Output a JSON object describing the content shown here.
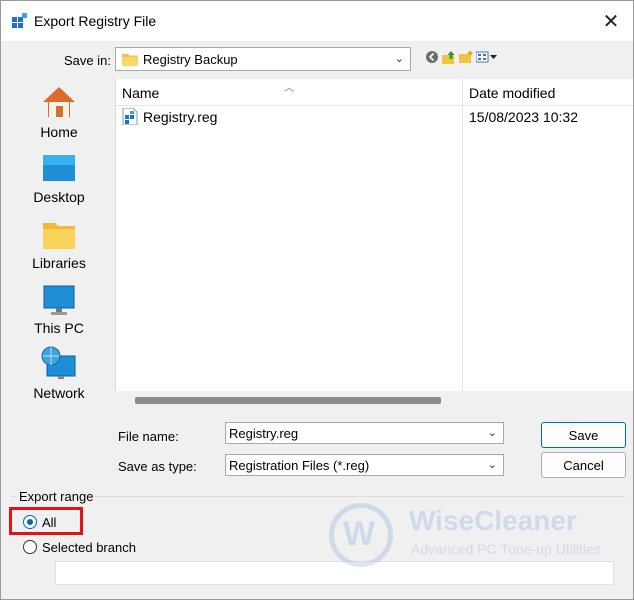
{
  "window": {
    "title": "Export Registry File"
  },
  "save_in": {
    "label": "Save in:",
    "value": "Registry Backup"
  },
  "places": [
    {
      "label": "Home",
      "icon": "home-icon"
    },
    {
      "label": "Desktop",
      "icon": "desktop-icon"
    },
    {
      "label": "Libraries",
      "icon": "libraries-icon"
    },
    {
      "label": "This PC",
      "icon": "this-pc-icon"
    },
    {
      "label": "Network",
      "icon": "network-icon"
    }
  ],
  "file_list": {
    "columns": [
      "Name",
      "Date modified"
    ],
    "rows": [
      {
        "name": "Registry.reg",
        "date": "15/08/2023 10:32"
      }
    ]
  },
  "file_name": {
    "label": "File name:",
    "value": "Registry.reg"
  },
  "save_as_type": {
    "label": "Save as type:",
    "value": "Registration Files (*.reg)"
  },
  "buttons": {
    "save": "Save",
    "cancel": "Cancel"
  },
  "export_range": {
    "title": "Export range",
    "options": [
      {
        "label": "All",
        "selected": true
      },
      {
        "label": "Selected branch",
        "selected": false
      }
    ],
    "branch_value": ""
  },
  "watermark": {
    "title": "WiseCleaner",
    "subtitle": "Advanced PC Tune-up Utilities",
    "letter": "W"
  },
  "colors": {
    "accent": "#0067c0",
    "highlight": "#e0131a"
  }
}
